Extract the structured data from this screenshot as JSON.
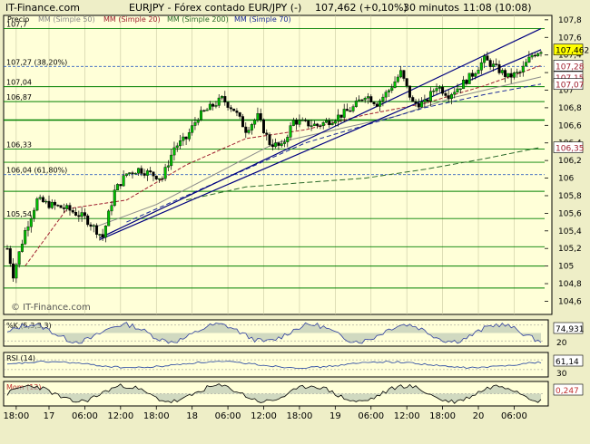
{
  "header": {
    "brand": "IT-Finance.com",
    "title": "EURJPY - Fórex contado EUR/JPY (-)",
    "quote": "107,462 (+0,10%)",
    "timeframe": "30 minutos",
    "time": "11:08 (10:08)"
  },
  "legend": [
    {
      "label": "Precio",
      "color": "#000000"
    },
    {
      "label": "MM (Simple 50)",
      "color": "#8a8a8a"
    },
    {
      "label": "MM (Simple 20)",
      "color": "#a02030"
    },
    {
      "label": "MM (Simple 200)",
      "color": "#2a6a2a"
    },
    {
      "label": "MM (Simple 70)",
      "color": "#1a2a9a"
    }
  ],
  "watermark": "© IT-Finance.com",
  "colors": {
    "background": "#eeeec7",
    "plot": "#ffffd8",
    "candle_up": "#00c000",
    "candle_down": "#000000",
    "horizontal_line": "#008000",
    "trendline": "#000080",
    "price_tag_current": "#ffff00"
  },
  "chart_data": {
    "type": "candlestick",
    "ylim": [
      104.45,
      107.85
    ],
    "yticks": [
      "104,6",
      "104,8",
      "105",
      "105,2",
      "105,4",
      "105,6",
      "105,8",
      "106",
      "106,2",
      "106,4",
      "106,6",
      "106,8",
      "107",
      "107,2",
      "107,4",
      "107,6",
      "107,8"
    ],
    "xticks": [
      "18:00",
      "17",
      "06:00",
      "12:00",
      "18:00",
      "18",
      "06:00",
      "12:00",
      "18:00",
      "19",
      "06:00",
      "12:00",
      "18:00",
      "20",
      "06:00"
    ],
    "xtick_index": [
      3,
      14,
      26,
      38,
      50,
      62,
      74,
      86,
      98,
      110,
      122,
      134,
      146,
      158,
      170
    ],
    "candle_count": 180,
    "support_resistance": [
      {
        "label": "107,7",
        "value": 107.7
      },
      {
        "label": "107,27 (38,20%)",
        "value": 107.27
      },
      {
        "label": "107,04",
        "value": 107.04
      },
      {
        "label": "106,87",
        "value": 106.87
      },
      {
        "label": "",
        "value": 106.66
      },
      {
        "label": "106,33",
        "value": 106.33
      },
      {
        "label": "",
        "value": 106.18
      },
      {
        "label": "106,04 (61,80%)",
        "value": 106.04
      },
      {
        "label": "",
        "value": 105.85
      },
      {
        "label": "105,54",
        "value": 105.54
      },
      {
        "label": "",
        "value": 105.22
      },
      {
        "label": "",
        "value": 105.0
      },
      {
        "label": "",
        "value": 104.75
      }
    ],
    "price_tags": [
      {
        "label": "107,462",
        "value": 107.462,
        "current": true
      },
      {
        "label": "107,28",
        "value": 107.28
      },
      {
        "label": "107,15",
        "value": 107.15
      },
      {
        "label": "107,07",
        "value": 107.07
      },
      {
        "label": "106,35",
        "value": 106.35
      }
    ],
    "price_anchors": [
      [
        0,
        105.2
      ],
      [
        2,
        104.9
      ],
      [
        6,
        105.4
      ],
      [
        10,
        105.75
      ],
      [
        14,
        105.7
      ],
      [
        20,
        105.65
      ],
      [
        26,
        105.55
      ],
      [
        32,
        105.33
      ],
      [
        36,
        105.85
      ],
      [
        40,
        106.05
      ],
      [
        44,
        106.1
      ],
      [
        48,
        106.05
      ],
      [
        52,
        106.0
      ],
      [
        56,
        106.35
      ],
      [
        60,
        106.45
      ],
      [
        64,
        106.7
      ],
      [
        68,
        106.8
      ],
      [
        72,
        106.9
      ],
      [
        76,
        106.78
      ],
      [
        80,
        106.55
      ],
      [
        84,
        106.7
      ],
      [
        88,
        106.4
      ],
      [
        92,
        106.35
      ],
      [
        96,
        106.65
      ],
      [
        100,
        106.62
      ],
      [
        104,
        106.6
      ],
      [
        108,
        106.65
      ],
      [
        112,
        106.72
      ],
      [
        116,
        106.8
      ],
      [
        120,
        106.95
      ],
      [
        124,
        106.85
      ],
      [
        128,
        107.0
      ],
      [
        132,
        107.2
      ],
      [
        136,
        106.85
      ],
      [
        140,
        106.85
      ],
      [
        144,
        107.05
      ],
      [
        148,
        106.95
      ],
      [
        152,
        107.05
      ],
      [
        156,
        107.18
      ],
      [
        160,
        107.35
      ],
      [
        164,
        107.25
      ],
      [
        168,
        107.15
      ],
      [
        172,
        107.2
      ],
      [
        176,
        107.4
      ],
      [
        179,
        107.46
      ]
    ],
    "moving_averages": [
      {
        "name": "MM (Simple 20)",
        "color": "#a02030",
        "dash": "4,2",
        "points": [
          [
            6,
            105.0
          ],
          [
            20,
            105.65
          ],
          [
            40,
            105.75
          ],
          [
            60,
            106.15
          ],
          [
            80,
            106.45
          ],
          [
            100,
            106.55
          ],
          [
            120,
            106.72
          ],
          [
            140,
            106.85
          ],
          [
            160,
            107.05
          ],
          [
            179,
            107.28
          ]
        ]
      },
      {
        "name": "MM (Simple 50)",
        "color": "#8a8a8a",
        "dash": "",
        "points": [
          [
            30,
            105.45
          ],
          [
            50,
            105.7
          ],
          [
            70,
            106.05
          ],
          [
            90,
            106.4
          ],
          [
            110,
            106.55
          ],
          [
            130,
            106.7
          ],
          [
            150,
            106.92
          ],
          [
            179,
            107.15
          ]
        ]
      },
      {
        "name": "MM (Simple 70)",
        "color": "#1a2a9a",
        "dash": "5,3",
        "points": [
          [
            40,
            105.5
          ],
          [
            60,
            105.8
          ],
          [
            80,
            106.1
          ],
          [
            100,
            106.4
          ],
          [
            120,
            106.6
          ],
          [
            140,
            106.8
          ],
          [
            160,
            106.95
          ],
          [
            179,
            107.07
          ]
        ]
      },
      {
        "name": "MM (Simple 200)",
        "color": "#2a6a2a",
        "dash": "6,3",
        "points": [
          [
            60,
            105.75
          ],
          [
            80,
            105.9
          ],
          [
            100,
            105.95
          ],
          [
            120,
            106.0
          ],
          [
            140,
            106.1
          ],
          [
            160,
            106.22
          ],
          [
            179,
            106.35
          ]
        ]
      }
    ],
    "trendlines": [
      {
        "points": [
          [
            31,
            105.3
          ],
          [
            179,
            107.46
          ]
        ]
      },
      {
        "points": [
          [
            31,
            105.32
          ],
          [
            179,
            107.7
          ]
        ]
      }
    ],
    "indicators": [
      {
        "name": "%K (5,3,3,3)",
        "value": "74,931",
        "low_label": "20",
        "high": 100,
        "low": 0,
        "ref": [
          20,
          80
        ]
      },
      {
        "name": "RSI (14)",
        "value": "61,14",
        "low_label": "30",
        "high": 100,
        "low": 0,
        "ref": [
          30,
          70
        ]
      },
      {
        "name": "Mom (12)",
        "value": "0,247",
        "low_label": "",
        "high": 1,
        "low": -1,
        "ref": [
          0
        ]
      }
    ]
  }
}
